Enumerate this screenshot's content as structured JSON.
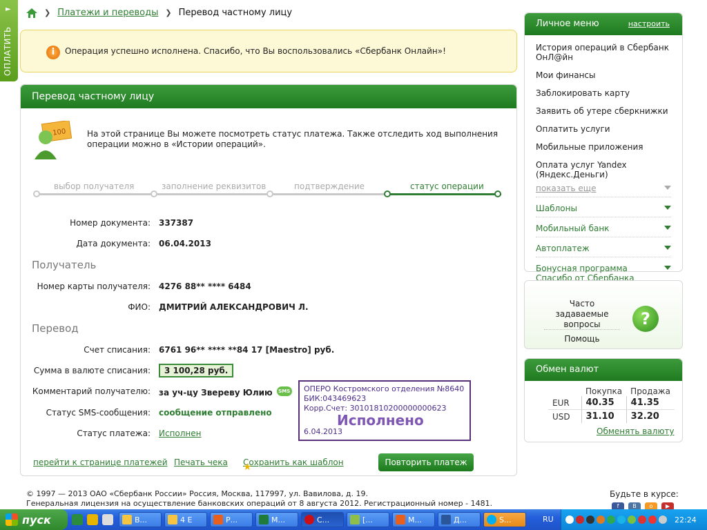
{
  "left_tab": {
    "label": "ОПЛАТИТЬ"
  },
  "breadcrumb": {
    "parent": "Платежи и переводы",
    "current": "Перевод частному лицу"
  },
  "success": {
    "message": "Операция успешно исполнена. Спасибо, что Вы воспользовались «Сбербанк Онлайн»!"
  },
  "panel": {
    "title": "Перевод частному лицу",
    "intro": "На этой странице Вы можете посмотреть статус платежа. Также отследить ход выполнения операции можно в «Истории операций».",
    "steps": [
      "выбор получателя",
      "заполнение реквизитов",
      "подтверждение",
      "статус операции"
    ],
    "active_step": 3
  },
  "details": {
    "doc_number_label": "Номер документа:",
    "doc_number": "337387",
    "doc_date_label": "Дата документа:",
    "doc_date": "06.04.2013",
    "recipient_section": "Получатель",
    "card_label": "Номер карты получателя:",
    "card": "4276 88** **** 6484",
    "name_label": "ФИО:",
    "name": "ДМИТРИЙ АЛЕКСАНДРОВИЧ Л.",
    "transfer_section": "Перевод",
    "account_label": "Счет списания:",
    "account": "6761 96** **** **84 17  [Maestro]  руб.",
    "sum_label": "Сумма в валюте списания:",
    "sum": "3 100,28  руб.",
    "comment_label": "Комментарий получателю:",
    "comment": "за уч-цу Звереву Юлию",
    "sms_badge": "SMS",
    "sms_label": "Статус SMS-сообщения:",
    "sms_status": "сообщение отправлено",
    "status_label": "Статус платежа:",
    "status": "Исполнен"
  },
  "stamp": {
    "line1": "ОПЕРО Костромского отделения №8640",
    "line2": "БИК:043469623",
    "line3": "Корр.Счет: 30101810200000000623",
    "big": "Исполнено",
    "date": "6.04.2013"
  },
  "actions": {
    "to_payments": "перейти к странице платежей",
    "print": "Печать чека",
    "save_template": "Сохранить как шаблон",
    "repeat": "Повторить платеж"
  },
  "personal_menu": {
    "title": "Личное меню",
    "setup": "настроить",
    "items": [
      "История операций в Сбербанк ОнЛ@йн",
      "Мои финансы",
      "Заблокировать карту",
      "Заявить об утере сберкнижки",
      "Оплатить услуги",
      "Мобильные приложения",
      "Оплата услуг Yandex (Яндекс.Деньги)"
    ],
    "show_more": "показать еще",
    "expandable": [
      "Шаблоны",
      "Мобильный банк",
      "Автоплатеж",
      "Бонусная программа Спасибо от Сбербанка"
    ]
  },
  "faq": {
    "title": "Часто задаваемые вопросы",
    "help": "Помощь",
    "icon": "?"
  },
  "exchange": {
    "title": "Обмен валют",
    "col_buy": "Покупка",
    "col_sell": "Продажа",
    "rows": [
      {
        "cur": "EUR",
        "buy": "40.35",
        "sell": "41.35"
      },
      {
        "cur": "USD",
        "buy": "31.10",
        "sell": "32.20"
      }
    ],
    "change_link": "Обменять валюту"
  },
  "footer": {
    "line1": "© 1997 — 2013 ОАО «Сбербанк России» Россия, Москва, 117997, ул. Вавилова, д. 19.",
    "line2": "Генеральная лицензия на осуществление банковских операций от 8 августа 2012. Регистрационный номер - 1481.",
    "keep_title": "Будьте в курсе:"
  },
  "taskbar": {
    "start": "пуск",
    "tasks": [
      "В...",
      "4 Е",
      "Р...",
      "М...",
      "С...",
      "[...",
      "М...",
      "Д...",
      "S..."
    ],
    "lang": "RU",
    "clock": "22:24"
  }
}
